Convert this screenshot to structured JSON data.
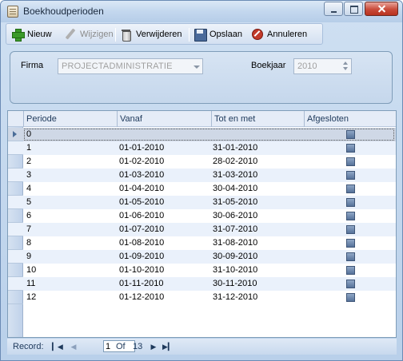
{
  "window": {
    "title": "Boekhoudperioden",
    "app_icon": "ledger-icon",
    "controls": [
      "minimize-icon",
      "maximize-icon",
      "close-icon"
    ]
  },
  "toolbar": {
    "new_label": "Nieuw",
    "edit_label": "Wijzigen",
    "delete_label": "Verwijderen",
    "save_label": "Opslaan",
    "cancel_label": "Annuleren"
  },
  "filter": {
    "firma_label": "Firma",
    "firma_value": "PROJECTADMINISTRATIE",
    "boekjaar_label": "Boekjaar",
    "boekjaar_value": "2010"
  },
  "grid": {
    "columns": [
      "Periode",
      "Vanaf",
      "Tot en met",
      "Afgesloten"
    ],
    "rows": [
      {
        "periode": "0",
        "vanaf": "",
        "tot": "",
        "afgesloten": true
      },
      {
        "periode": "1",
        "vanaf": "01-01-2010",
        "tot": "31-01-2010",
        "afgesloten": true
      },
      {
        "periode": "2",
        "vanaf": "01-02-2010",
        "tot": "28-02-2010",
        "afgesloten": true
      },
      {
        "periode": "3",
        "vanaf": "01-03-2010",
        "tot": "31-03-2010",
        "afgesloten": true
      },
      {
        "periode": "4",
        "vanaf": "01-04-2010",
        "tot": "30-04-2010",
        "afgesloten": true
      },
      {
        "periode": "5",
        "vanaf": "01-05-2010",
        "tot": "31-05-2010",
        "afgesloten": true
      },
      {
        "periode": "6",
        "vanaf": "01-06-2010",
        "tot": "30-06-2010",
        "afgesloten": true
      },
      {
        "periode": "7",
        "vanaf": "01-07-2010",
        "tot": "31-07-2010",
        "afgesloten": true
      },
      {
        "periode": "8",
        "vanaf": "01-08-2010",
        "tot": "31-08-2010",
        "afgesloten": true
      },
      {
        "periode": "9",
        "vanaf": "01-09-2010",
        "tot": "30-09-2010",
        "afgesloten": true
      },
      {
        "periode": "10",
        "vanaf": "01-10-2010",
        "tot": "31-10-2010",
        "afgesloten": true
      },
      {
        "periode": "11",
        "vanaf": "01-11-2010",
        "tot": "30-11-2010",
        "afgesloten": true
      },
      {
        "periode": "12",
        "vanaf": "01-12-2010",
        "tot": "31-12-2010",
        "afgesloten": true
      }
    ],
    "selected_row": 0
  },
  "navigator": {
    "record_label": "Record:",
    "current": "1",
    "of_label": "Of",
    "total": "13"
  }
}
